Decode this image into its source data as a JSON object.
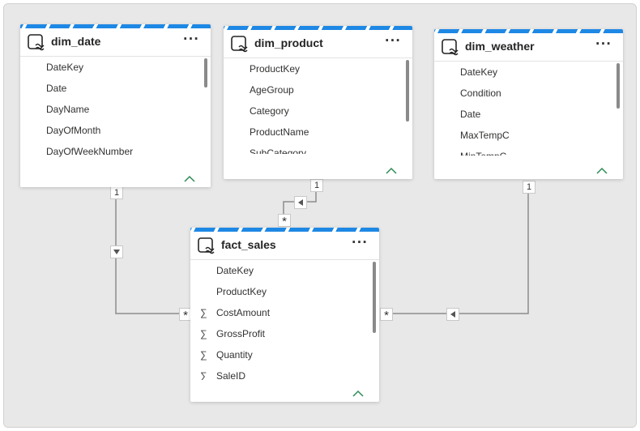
{
  "colors": {
    "accent": "#1e88e5",
    "line": "#8c8c8c",
    "collapse": "#2e8b57"
  },
  "tables": {
    "dim_date": {
      "title": "dim_date",
      "more": "···",
      "fields": [
        {
          "name": "DateKey",
          "measure": false
        },
        {
          "name": "Date",
          "measure": false
        },
        {
          "name": "DayName",
          "measure": false
        },
        {
          "name": "DayOfMonth",
          "measure": false
        },
        {
          "name": "DayOfWeekNumber",
          "measure": false
        }
      ]
    },
    "dim_product": {
      "title": "dim_product",
      "more": "···",
      "fields": [
        {
          "name": "ProductKey",
          "measure": false
        },
        {
          "name": "AgeGroup",
          "measure": false
        },
        {
          "name": "Category",
          "measure": false
        },
        {
          "name": "ProductName",
          "measure": false
        },
        {
          "name": "SubCategory",
          "measure": false
        }
      ]
    },
    "dim_weather": {
      "title": "dim_weather",
      "more": "···",
      "fields": [
        {
          "name": "DateKey",
          "measure": false
        },
        {
          "name": "Condition",
          "measure": false
        },
        {
          "name": "Date",
          "measure": false
        },
        {
          "name": "MaxTempC",
          "measure": false
        },
        {
          "name": "MinTempC",
          "measure": false
        }
      ]
    },
    "fact_sales": {
      "title": "fact_sales",
      "more": "···",
      "fields": [
        {
          "name": "DateKey",
          "measure": false
        },
        {
          "name": "ProductKey",
          "measure": false
        },
        {
          "name": "CostAmount",
          "measure": true
        },
        {
          "name": "GrossProfit",
          "measure": true
        },
        {
          "name": "Quantity",
          "measure": true
        },
        {
          "name": "SaleID",
          "measure": true
        }
      ]
    }
  },
  "relationships": [
    {
      "from": "dim_date",
      "to": "fact_sales",
      "one": "1",
      "many": "*"
    },
    {
      "from": "dim_product",
      "to": "fact_sales",
      "one": "1",
      "many": "*"
    },
    {
      "from": "dim_weather",
      "to": "fact_sales",
      "one": "1",
      "many": "*"
    }
  ],
  "sigma": "∑"
}
